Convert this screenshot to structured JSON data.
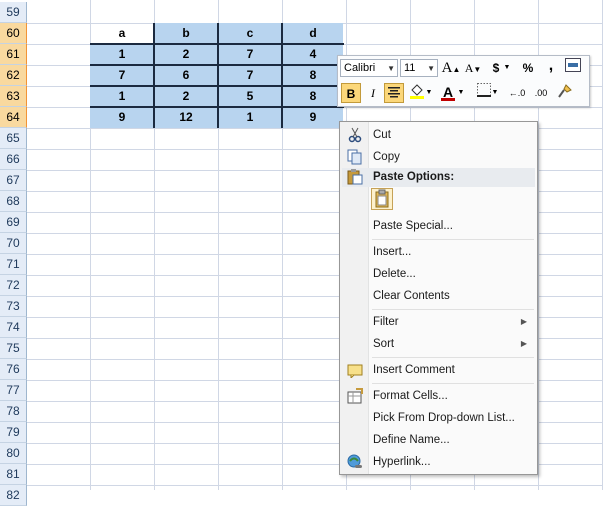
{
  "rows": [
    "59",
    "60",
    "61",
    "62",
    "63",
    "64",
    "65",
    "66",
    "67",
    "68",
    "69",
    "70",
    "71",
    "72",
    "73",
    "74",
    "75",
    "76",
    "77",
    "78",
    "79",
    "80",
    "81",
    "82"
  ],
  "table": {
    "headers": [
      "a",
      "b",
      "c",
      "d"
    ],
    "data": [
      [
        "1",
        "2",
        "7",
        "4"
      ],
      [
        "7",
        "6",
        "7",
        "8"
      ],
      [
        "1",
        "2",
        "5",
        "8"
      ],
      [
        "9",
        "12",
        "1",
        "9"
      ]
    ]
  },
  "toolbar": {
    "font": "Calibri",
    "size": "11",
    "grow_font": "A",
    "shrink_font": "A",
    "currency": "$",
    "percent": "%",
    "comma": ",",
    "bold": "B",
    "italic": "I",
    "font_color": "A",
    "inc_decimal": "←.0",
    "dec_decimal": ".00",
    "colors": {
      "highlight": "#ffff00",
      "font": "#c00000"
    }
  },
  "menu": {
    "items": {
      "cut": "Cut",
      "copy": "Copy",
      "paste_options": "Paste Options:",
      "paste_special": "Paste Special...",
      "insert": "Insert...",
      "delete": "Delete...",
      "clear_contents": "Clear Contents",
      "filter": "Filter",
      "sort": "Sort",
      "insert_comment": "Insert Comment",
      "format_cells": "Format Cells...",
      "pick_list": "Pick From Drop-down List...",
      "define_name": "Define Name...",
      "hyperlink": "Hyperlink..."
    },
    "icons": [
      "scissors-icon",
      "copy-icon",
      "paste-icon",
      "comment-icon",
      "format-cells-icon",
      "hyperlink-icon"
    ]
  }
}
